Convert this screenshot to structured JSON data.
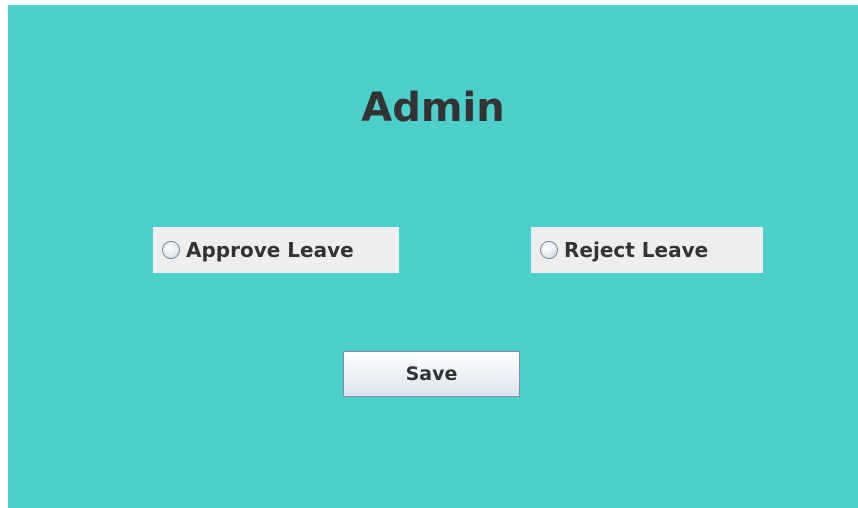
{
  "page": {
    "title": "Admin"
  },
  "options": {
    "approve_label": "Approve Leave",
    "reject_label": "Reject Leave"
  },
  "actions": {
    "save_label": "Save"
  },
  "colors": {
    "panel_background": "#4dd0cc",
    "option_background": "#eeeeee",
    "text": "#333333"
  }
}
